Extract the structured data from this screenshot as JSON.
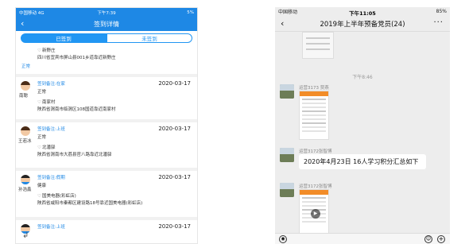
{
  "left": {
    "status": {
      "carrier": "中国移动 4G",
      "time": "下午7:39",
      "battery": "5%"
    },
    "title": "签到详情",
    "tabs": {
      "signed": "已签到",
      "unsigned": "未签到"
    },
    "cards": [
      {
        "status": "正常",
        "place": "新野庄",
        "address": "四川省宜宾市屏山县001乡道靠近新野庄"
      },
      {
        "note": "签到备注:在家",
        "date": "2020-03-17",
        "name": "南聪",
        "status": "正常",
        "place": "南家村",
        "address": "陕西省渭南市临渭区108国道靠近南家村"
      },
      {
        "note": "签到备注:上班",
        "date": "2020-03-17",
        "name": "王若冰",
        "status": "正常",
        "place": "北潘驿",
        "address": "陕西省渭南市大荔县官八路靠近北潘驿"
      },
      {
        "note": "签到备注:假期",
        "date": "2020-03-17",
        "name": "孙浩鑫",
        "status": "健康",
        "place": "国美电器(彩虹店)",
        "address": "陕西省咸阳市秦都区建设路18号靠近国美电器(彩虹店)"
      },
      {
        "note": "签到备注:上班",
        "date": "2020-03-17",
        "name": "",
        "status": "",
        "place": "",
        "address": ""
      }
    ],
    "icons": {
      "back": "chevron-left-icon",
      "location": "location-pin-icon",
      "return": "return-arrow-icon"
    }
  },
  "right": {
    "status": {
      "carrier": "中国移动",
      "time": "下午11:05",
      "battery": "85%"
    },
    "title": "2019年上半年预备党员(24)",
    "timestamp": "下午8:46",
    "messages": [
      {
        "sender": "运营3173  贾燕",
        "type": "image"
      },
      {
        "sender": "运营3172张智博",
        "type": "text",
        "text": "2020年4月23日 16人学习积分汇总如下"
      },
      {
        "sender": "运营3172张智博",
        "type": "video"
      }
    ],
    "icons": {
      "back": "chevron-left-icon",
      "more": "more-dots-icon",
      "voice": "voice-icon",
      "emoji": "emoji-icon",
      "plus": "plus-icon"
    }
  }
}
